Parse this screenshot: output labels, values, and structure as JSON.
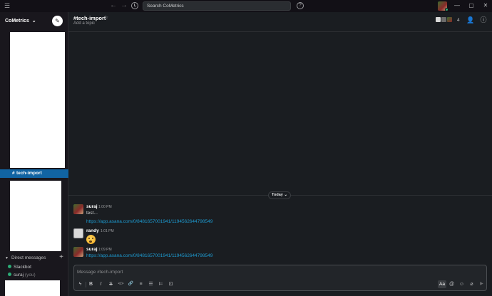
{
  "titlebar": {
    "menu_icon": "hamburger-icon",
    "search_placeholder": "Search CoMetrics",
    "help_icon": "?",
    "win_min": "—",
    "win_max": "▢",
    "win_close": "✕"
  },
  "sidebar": {
    "workspace": "CoMetrics",
    "workspace_caret": "⌄",
    "compose_icon": "✎",
    "channel": {
      "hash": "#",
      "name": "tech-import"
    },
    "dm_header": "Direct messages",
    "dm_caret": "▼",
    "dm_plus": "+",
    "dms": [
      {
        "name": "Slackbot",
        "suffix": ""
      },
      {
        "name": "suraj",
        "suffix": "(you)"
      }
    ]
  },
  "channel_header": {
    "title": "#tech-import",
    "star": "☆",
    "topic": "Add a topic",
    "member_count": "4"
  },
  "divider": {
    "label": "Today",
    "caret": "⌄"
  },
  "messages": [
    {
      "author": "suraj",
      "time": "1:00 PM",
      "text": "test...",
      "link": "https://app.asana.com/0/848165700194​1/1194562644798549"
    },
    {
      "author": "randy",
      "time": "1:01 PM",
      "emoji": "astonished-face"
    },
    {
      "author": "suraj",
      "time": "1:09 PM",
      "link": "https://app.asana.com/0/848165700194​1/1194562644798549"
    }
  ],
  "composer": {
    "placeholder": "Message #tech-import",
    "toolbar": {
      "lightning": "ϟ",
      "bold": "B",
      "italic": "I",
      "strike": "S",
      "code": "</>",
      "link": "🔗",
      "ordered_list": "≡",
      "bullet_list": "☰",
      "block_quote": "⊨",
      "code_block": "⊡",
      "format": "Aa",
      "mention": "@",
      "emoji": "☺",
      "attach": "⌀",
      "send": "▶"
    }
  },
  "colors": {
    "accent": "#1164a3",
    "link": "#1d9bd1",
    "presence": "#2bac76"
  }
}
